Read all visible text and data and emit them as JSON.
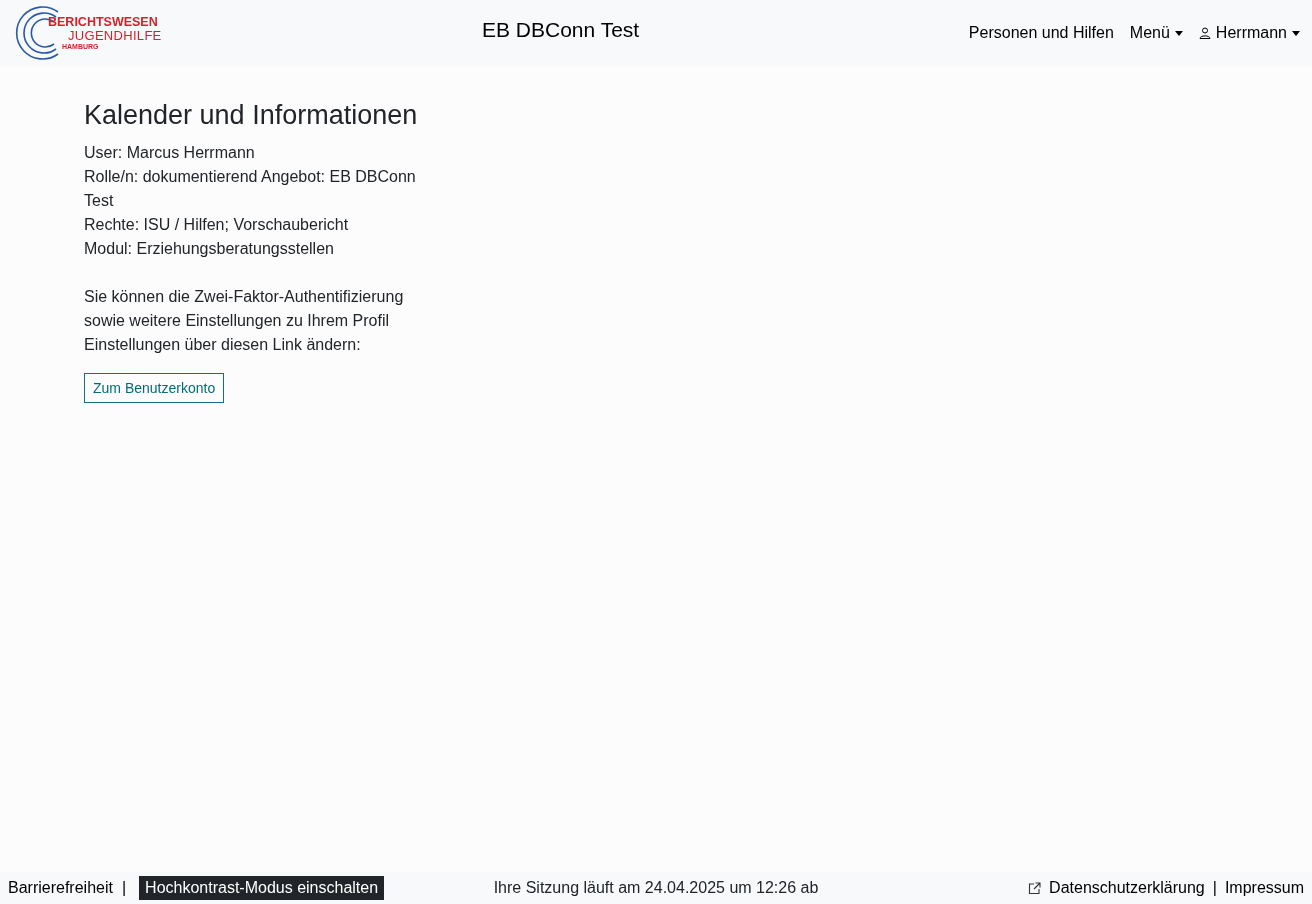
{
  "logo": {
    "line_1": "BERICHTSWESEN",
    "line_2": "JUGENDHILFE",
    "line_3": "HAMBURG"
  },
  "header": {
    "title": "EB DBConn Test",
    "nav": [
      {
        "label": "Personen und Hilfen",
        "kind": "link"
      },
      {
        "label": "Menü",
        "kind": "dropdown"
      },
      {
        "label": "Herrmann",
        "kind": "user"
      }
    ]
  },
  "main": {
    "heading": "Kalender und Informationen",
    "info_lines": [
      "User: Marcus Herrmann",
      "Rolle/n: dokumentierend Angebot: EB DBConn Test",
      "Rechte: ISU / Hilfen; Vorschaubericht",
      "Modul: Erziehungsberatungsstellen"
    ],
    "paragraph": "Sie können die Zwei-Faktor-Authentifizierung sowie weitere Einstellungen zu Ihrem Profil Einstellungen über diesen Link ändern:",
    "button": "Zum Benutzerkonto"
  },
  "footer": {
    "left": [
      {
        "label": "Barrierefreiheit",
        "kind": "link"
      },
      {
        "label": "|",
        "kind": "separator"
      },
      {
        "label": "Hochkontrast-Modus einschalten",
        "kind": "toggle"
      }
    ],
    "session": "Ihre Sitzung läuft am 24.04.2025 um 12:26 ab",
    "right": [
      {
        "label": "Datenschutzerklärung",
        "kind": "external"
      },
      {
        "label": "|",
        "kind": "separator"
      },
      {
        "label": "Impressum",
        "kind": "link"
      }
    ]
  }
}
